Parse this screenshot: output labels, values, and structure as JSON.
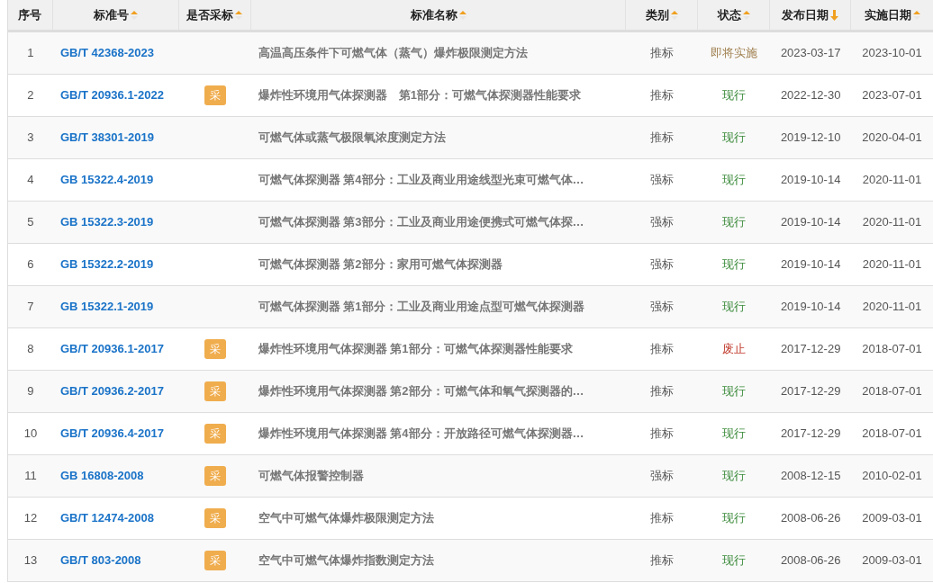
{
  "columns": [
    {
      "label": "序号"
    },
    {
      "label": "标准号",
      "sortable": true,
      "sort_active": false
    },
    {
      "label": "是否采标",
      "sortable": true,
      "sort_active": false
    },
    {
      "label": "标准名称",
      "sortable": true,
      "sort_active": false
    },
    {
      "label": "类别",
      "sortable": true,
      "sort_active": false
    },
    {
      "label": "状态",
      "sortable": true,
      "sort_active": false
    },
    {
      "label": "发布日期",
      "sortable": true,
      "sort_active": true
    },
    {
      "label": "实施日期",
      "sortable": true,
      "sort_active": false
    }
  ],
  "rows": [
    {
      "no": "1",
      "code": "GB/T 42368-2023",
      "name": "高温高压条件下可燃气体（蒸气）爆炸极限测定方法",
      "category": "推标",
      "status": {
        "text": "即将实施",
        "color": "#a08050"
      },
      "published": "2023-03-17",
      "effective": "2023-10-01"
    },
    {
      "no": "2",
      "code": "GB/T 20936.1-2022",
      "adopted": "采",
      "name": "爆炸性环境用气体探测器　第1部分：可燃气体探测器性能要求",
      "category": "推标",
      "status": {
        "text": "现行",
        "color": "#3a8a3a"
      },
      "published": "2022-12-30",
      "effective": "2023-07-01"
    },
    {
      "no": "3",
      "code": "GB/T 38301-2019",
      "name": "可燃气体或蒸气极限氧浓度测定方法",
      "category": "推标",
      "status": {
        "text": "现行",
        "color": "#3a8a3a"
      },
      "published": "2019-12-10",
      "effective": "2020-04-01"
    },
    {
      "no": "4",
      "code": "GB 15322.4-2019",
      "name": "可燃气体探测器 第4部分：工业及商业用途线型光束可燃气体…",
      "category": "强标",
      "status": {
        "text": "现行",
        "color": "#3a8a3a"
      },
      "published": "2019-10-14",
      "effective": "2020-11-01"
    },
    {
      "no": "5",
      "code": "GB 15322.3-2019",
      "name": "可燃气体探测器 第3部分：工业及商业用途便携式可燃气体探…",
      "category": "强标",
      "status": {
        "text": "现行",
        "color": "#3a8a3a"
      },
      "published": "2019-10-14",
      "effective": "2020-11-01"
    },
    {
      "no": "6",
      "code": "GB 15322.2-2019",
      "name": "可燃气体探测器 第2部分：家用可燃气体探测器",
      "category": "强标",
      "status": {
        "text": "现行",
        "color": "#3a8a3a"
      },
      "published": "2019-10-14",
      "effective": "2020-11-01"
    },
    {
      "no": "7",
      "code": "GB 15322.1-2019",
      "name": "可燃气体探测器 第1部分：工业及商业用途点型可燃气体探测器",
      "category": "强标",
      "status": {
        "text": "现行",
        "color": "#3a8a3a"
      },
      "published": "2019-10-14",
      "effective": "2020-11-01"
    },
    {
      "no": "8",
      "code": "GB/T 20936.1-2017",
      "adopted": "采",
      "name": "爆炸性环境用气体探测器 第1部分：可燃气体探测器性能要求",
      "category": "推标",
      "status": {
        "text": "废止",
        "color": "#c0392b"
      },
      "published": "2017-12-29",
      "effective": "2018-07-01"
    },
    {
      "no": "9",
      "code": "GB/T 20936.2-2017",
      "adopted": "采",
      "name": "爆炸性环境用气体探测器 第2部分：可燃气体和氧气探测器的…",
      "category": "推标",
      "status": {
        "text": "现行",
        "color": "#3a8a3a"
      },
      "published": "2017-12-29",
      "effective": "2018-07-01"
    },
    {
      "no": "10",
      "code": "GB/T 20936.4-2017",
      "adopted": "采",
      "name": "爆炸性环境用气体探测器 第4部分：开放路径可燃气体探测器…",
      "category": "推标",
      "status": {
        "text": "现行",
        "color": "#3a8a3a"
      },
      "published": "2017-12-29",
      "effective": "2018-07-01"
    },
    {
      "no": "11",
      "code": "GB 16808-2008",
      "adopted": "采",
      "name": "可燃气体报警控制器",
      "category": "强标",
      "status": {
        "text": "现行",
        "color": "#3a8a3a"
      },
      "published": "2008-12-15",
      "effective": "2010-02-01"
    },
    {
      "no": "12",
      "code": "GB/T 12474-2008",
      "adopted": "采",
      "name": "空气中可燃气体爆炸极限测定方法",
      "category": "推标",
      "status": {
        "text": "现行",
        "color": "#3a8a3a"
      },
      "published": "2008-06-26",
      "effective": "2009-03-01"
    },
    {
      "no": "13",
      "code": "GB/T 803-2008",
      "adopted": "采",
      "name": "空气中可燃气体爆炸指数测定方法",
      "category": "推标",
      "status": {
        "text": "现行",
        "color": "#3a8a3a"
      },
      "published": "2008-06-26",
      "effective": "2009-03-01"
    }
  ]
}
